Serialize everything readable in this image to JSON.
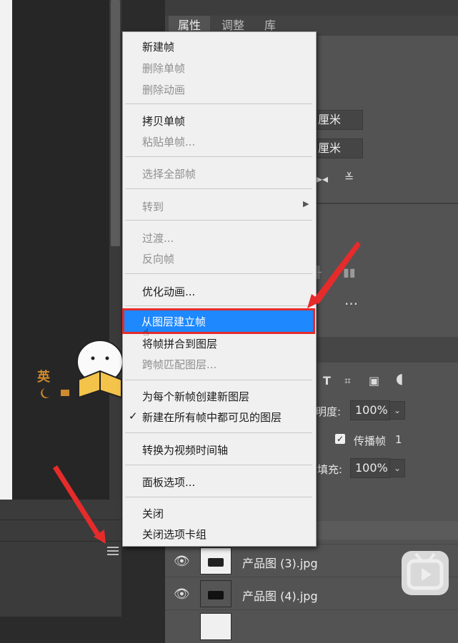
{
  "panel_tabs": [
    "属性",
    "调整",
    "库"
  ],
  "fields": {
    "width_unit": "厘米",
    "height_unit": "厘米"
  },
  "layer_props": {
    "opacity_label": "明度:",
    "opacity_value": "100%",
    "propagate_label": "传播帧",
    "propagate_num": "1",
    "fill_label": "填充:",
    "fill_value": "100%"
  },
  "layers": [
    {
      "name": "产品图 (3).jpg"
    },
    {
      "name": "产品图 (4).jpg"
    }
  ],
  "mascot_text": "英",
  "menu": {
    "items": [
      {
        "label": "新建帧",
        "disabled": false
      },
      {
        "label": "删除单帧",
        "disabled": true
      },
      {
        "label": "删除动画",
        "disabled": true
      },
      {
        "label": "拷贝单帧",
        "disabled": false
      },
      {
        "label": "粘贴单帧...",
        "disabled": true
      },
      {
        "label": "选择全部帧",
        "disabled": true
      },
      {
        "label": "转到",
        "disabled": true
      },
      {
        "label": "过渡...",
        "disabled": true
      },
      {
        "label": "反向帧",
        "disabled": true
      },
      {
        "label": "优化动画...",
        "disabled": false
      },
      {
        "label": "从图层建立帧",
        "disabled": false,
        "highlighted": true
      },
      {
        "label": "将帧拼合到图层",
        "disabled": false
      },
      {
        "label": "跨帧匹配图层...",
        "disabled": true
      },
      {
        "label": "为每个新帧创建新图层",
        "disabled": false
      },
      {
        "label": "新建在所有帧中都可见的图层",
        "disabled": false,
        "checked": true
      },
      {
        "label": "转换为视频时间轴",
        "disabled": false
      },
      {
        "label": "面板选项...",
        "disabled": false
      },
      {
        "label": "关闭",
        "disabled": false
      },
      {
        "label": "关闭选项卡组",
        "disabled": false
      }
    ]
  },
  "colors": {
    "highlight": "#1e88ff",
    "annotation": "#e62b2b"
  }
}
